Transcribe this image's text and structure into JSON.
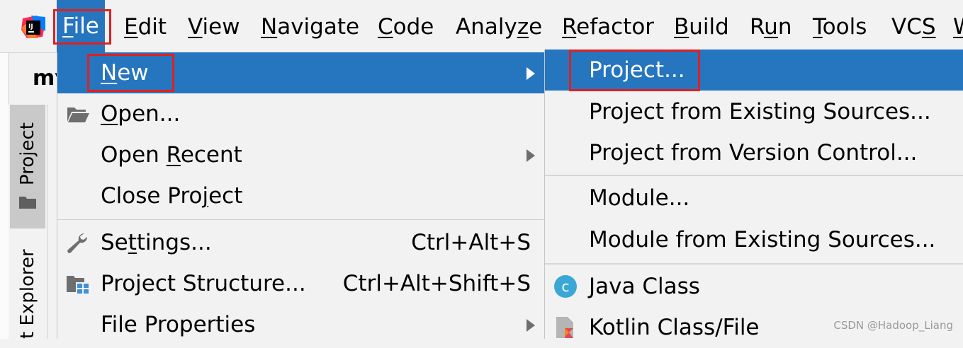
{
  "menubar": {
    "items": [
      {
        "label": "File",
        "mnemonic": "F",
        "rest": "ile"
      },
      {
        "label": "Edit",
        "mnemonic": "E",
        "rest": "dit"
      },
      {
        "label": "View",
        "mnemonic": "V",
        "rest": "iew"
      },
      {
        "label": "Navigate",
        "mnemonic": "N",
        "rest": "avigate"
      },
      {
        "label": "Code",
        "mnemonic": "C",
        "rest": "ode"
      },
      {
        "label": "Analyze",
        "pre": "Analy",
        "mnemonic": "z",
        "rest": "e"
      },
      {
        "label": "Refactor",
        "mnemonic": "R",
        "rest": "efactor"
      },
      {
        "label": "Build",
        "mnemonic": "B",
        "rest": "uild"
      },
      {
        "label": "Run",
        "pre": "R",
        "mnemonic": "u",
        "rest": "n"
      },
      {
        "label": "Tools",
        "mnemonic": "T",
        "rest": "ools"
      },
      {
        "label": "VCS",
        "pre": "VC",
        "mnemonic": "S",
        "rest": ""
      },
      {
        "label": "W",
        "mnemonic": "W",
        "rest": ""
      }
    ]
  },
  "background": {
    "editor_tab": "my",
    "tool_window_project": "Project",
    "tool_window_explorer": "t Explorer"
  },
  "file_menu": {
    "new": {
      "pre": "",
      "mnemonic": "N",
      "rest": "ew"
    },
    "open": {
      "pre": "",
      "mnemonic": "O",
      "rest": "pen..."
    },
    "open_recent": {
      "pre": "Open ",
      "mnemonic": "R",
      "rest": "ecent"
    },
    "close_project": {
      "pre": "Close Pro",
      "mnemonic": "j",
      "rest": "ect"
    },
    "settings": {
      "pre": "Se",
      "mnemonic": "t",
      "rest": "tings...",
      "shortcut": "Ctrl+Alt+S"
    },
    "project_structure": {
      "label": "Project Structure...",
      "shortcut": "Ctrl+Alt+Shift+S"
    },
    "file_properties": {
      "label": "File Properties"
    }
  },
  "new_submenu": {
    "project": "Project...",
    "project_existing": "Project from Existing Sources...",
    "project_vcs": "Project from Version Control...",
    "module": "Module...",
    "module_existing": "Module from Existing Sources...",
    "java_class": "Java Class",
    "kotlin_class": "Kotlin Class/File"
  },
  "icons": {
    "app": "intellij-logo-icon",
    "open": "folder-open-icon",
    "settings": "wrench-icon",
    "structure": "project-structure-icon",
    "java": "java-class-icon",
    "kotlin": "kotlin-file-icon"
  },
  "colors": {
    "selection": "#2675bf",
    "highlight_box": "#e02020",
    "menu_bg": "#f2f2f2"
  },
  "watermark": "CSDN @Hadoop_Liang"
}
